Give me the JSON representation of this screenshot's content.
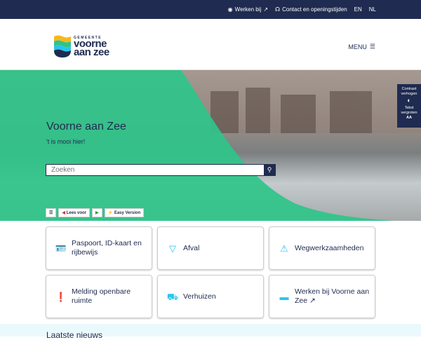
{
  "topbar": {
    "werken": "Werken bij",
    "contact": "Contact en openingstijden",
    "en": "EN",
    "nl": "NL"
  },
  "logo": {
    "small": "GEMEENTE",
    "line1": "voorne",
    "line2": "aan zee"
  },
  "menu": {
    "label": "MENU"
  },
  "hero": {
    "title": "Voorne aan Zee",
    "subtitle": "'t is mooi hier!",
    "search_placeholder": "Zoeken"
  },
  "readspeaker": {
    "listen": "Lees voor",
    "easy": "Easy Version"
  },
  "side": {
    "contrast": "Contrast verhogen",
    "text": "Tekst vergroten",
    "text_icon": "AA"
  },
  "tiles": [
    {
      "label": "Paspoort, ID-kaart en rijbewijs",
      "icon": "id-card-icon"
    },
    {
      "label": "Afval",
      "icon": "bin-icon"
    },
    {
      "label": "Wegwerkzaamheden",
      "icon": "roadwork-icon"
    },
    {
      "label": "Melding openbare ruimte",
      "icon": "report-icon"
    },
    {
      "label": "Verhuizen",
      "icon": "truck-icon"
    },
    {
      "label": "Werken bij Voorne aan Zee",
      "icon": "briefcase-icon"
    }
  ],
  "news": {
    "title": "Laatste nieuws"
  },
  "colors": {
    "navy": "#1f2b50",
    "green": "#2fc48a",
    "cyan": "#29c5ef"
  }
}
